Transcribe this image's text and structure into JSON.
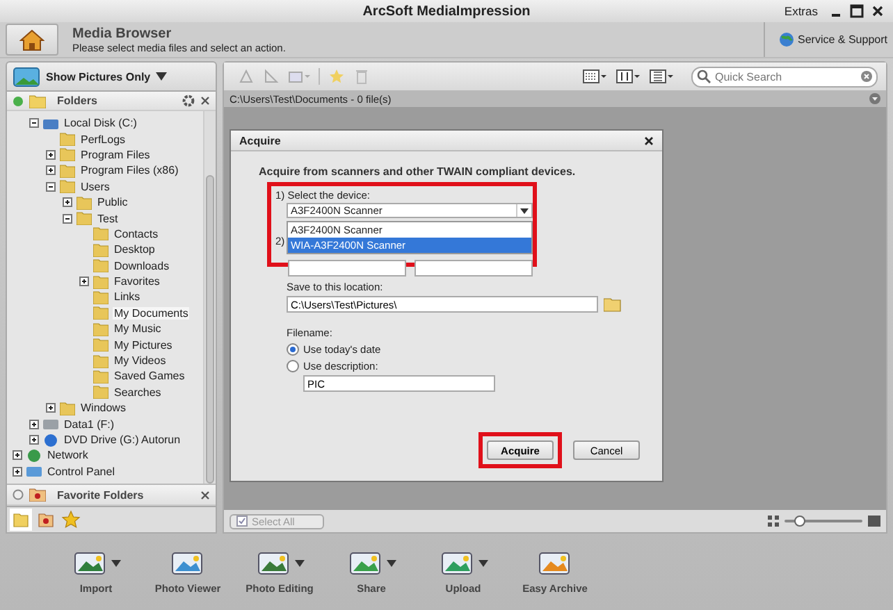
{
  "window": {
    "title": "ArcSoft MediaImpression",
    "extras": "Extras"
  },
  "header": {
    "title": "Media Browser",
    "subtitle": "Please select media files and select an action.",
    "support": "Service & Support"
  },
  "filter": {
    "label": "Show Pictures Only"
  },
  "folders": {
    "title": "Folders",
    "tree": [
      {
        "children": [
          {
            "label": "Local Disk (C:)",
            "kind": "drive",
            "expanded": true,
            "selected": false,
            "children": [
              {
                "label": "PerfLogs",
                "kind": "folder",
                "selected": false
              },
              {
                "label": "Program Files",
                "kind": "folder",
                "expanded": false,
                "selected": false
              },
              {
                "label": "Program Files (x86)",
                "kind": "folder",
                "expanded": false,
                "selected": false
              },
              {
                "label": "Users",
                "kind": "folder",
                "expanded": true,
                "selected": false,
                "children": [
                  {
                    "label": "Public",
                    "kind": "folder",
                    "expanded": false,
                    "selected": false
                  },
                  {
                    "label": "Test",
                    "kind": "folder",
                    "expanded": true,
                    "selected": false,
                    "children": [
                      {
                        "label": "Contacts",
                        "kind": "folder",
                        "selected": false
                      },
                      {
                        "label": "Desktop",
                        "kind": "folder",
                        "selected": false
                      },
                      {
                        "label": "Downloads",
                        "kind": "folder",
                        "selected": false
                      },
                      {
                        "label": "Favorites",
                        "kind": "folder",
                        "expanded": false,
                        "selected": false
                      },
                      {
                        "label": "Links",
                        "kind": "folder",
                        "selected": false
                      },
                      {
                        "label": "My Documents",
                        "kind": "folder",
                        "selected": true
                      },
                      {
                        "label": "My Music",
                        "kind": "folder",
                        "selected": false
                      },
                      {
                        "label": "My Pictures",
                        "kind": "folder",
                        "selected": false
                      },
                      {
                        "label": "My Videos",
                        "kind": "folder",
                        "selected": false
                      },
                      {
                        "label": "Saved Games",
                        "kind": "folder",
                        "selected": false
                      },
                      {
                        "label": "Searches",
                        "kind": "folder",
                        "selected": false
                      }
                    ]
                  }
                ]
              },
              {
                "label": "Windows",
                "kind": "folder",
                "expanded": false,
                "selected": false
              }
            ]
          },
          {
            "label": "Data1 (F:)",
            "kind": "harddisk",
            "expanded": false,
            "selected": false
          },
          {
            "label": "DVD Drive (G:) Autorun",
            "kind": "disc",
            "expanded": false,
            "selected": false
          }
        ]
      },
      {
        "label": "Network",
        "kind": "network",
        "expanded": false,
        "selected": false
      },
      {
        "label": "Control Panel",
        "kind": "panel",
        "expanded": false,
        "selected": false
      }
    ]
  },
  "favorites": {
    "title": "Favorite Folders"
  },
  "search": {
    "placeholder": "Quick Search"
  },
  "path": "C:\\Users\\Test\\Documents - 0 file(s)",
  "dialog": {
    "title": "Acquire",
    "heading": "Acquire from scanners and other TWAIN compliant devices.",
    "device_label": "1) Select the device:",
    "device_value": "A3F2400N Scanner",
    "highlighted": true,
    "options": [
      {
        "label": "A3F2400N Scanner",
        "selected": false
      },
      {
        "label": "WIA-A3F2400N Scanner",
        "selected": true
      }
    ],
    "step2_label": "2)",
    "location_label": "Save to this location:",
    "location_value": "C:\\Users\\Test\\Pictures\\",
    "filename_label": "Filename:",
    "radios": [
      {
        "label": "Use today's date",
        "selected": true
      },
      {
        "label": "Use description:",
        "selected": false
      }
    ],
    "description_value": "PIC",
    "buttons": [
      {
        "label": "Acquire",
        "highlighted": true
      },
      {
        "label": "Cancel",
        "highlighted": false
      }
    ]
  },
  "select_all": {
    "label": "Select All"
  },
  "zoom": {
    "level": 0.2
  },
  "actions": [
    {
      "label": "Import",
      "menu": true
    },
    {
      "label": "Photo Viewer",
      "menu": false
    },
    {
      "label": "Photo Editing",
      "menu": true
    },
    {
      "label": "Share",
      "menu": true
    },
    {
      "label": "Upload",
      "menu": true
    },
    {
      "label": "Easy Archive",
      "menu": false
    }
  ]
}
